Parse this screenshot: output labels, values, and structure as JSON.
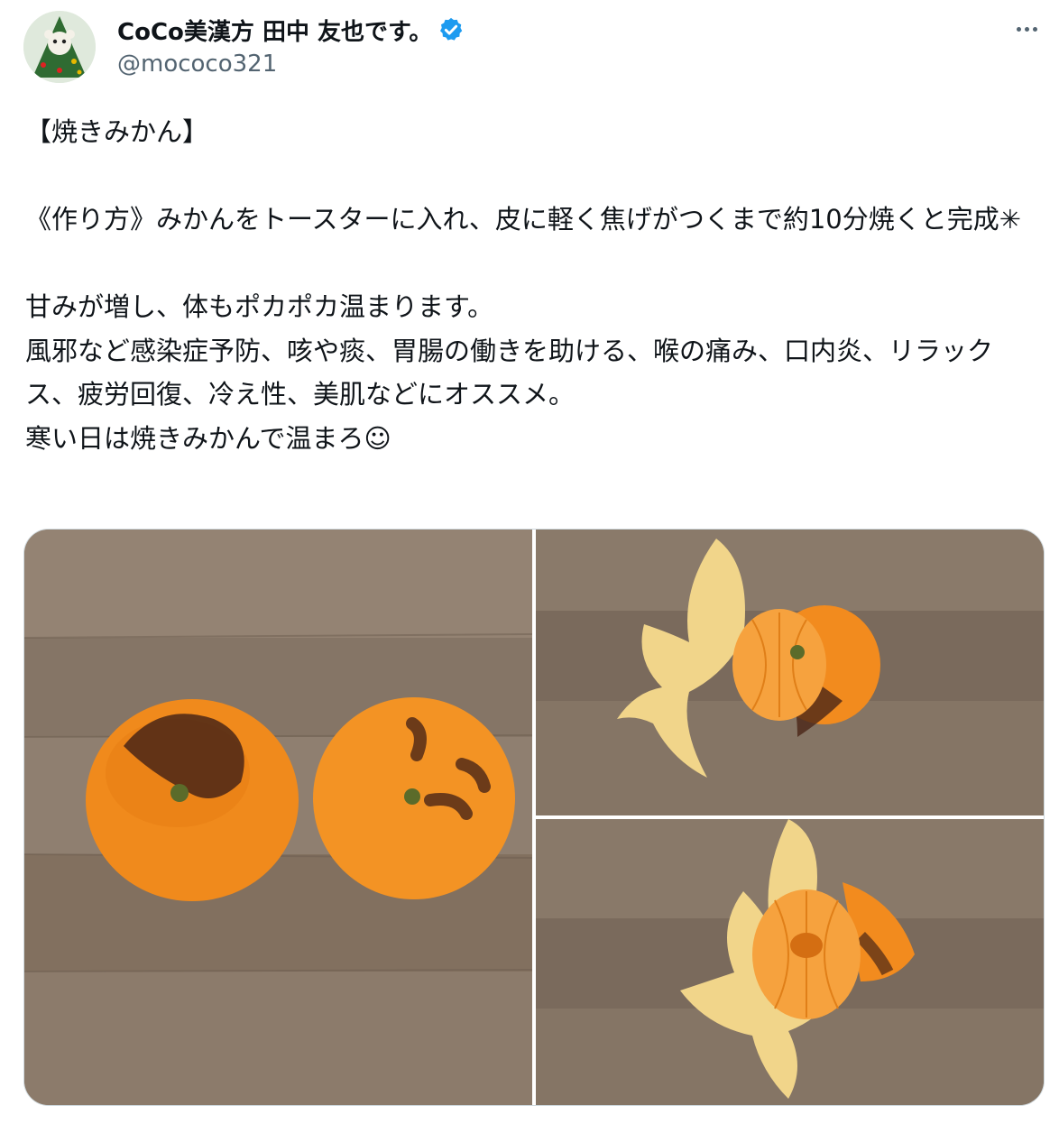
{
  "tweet": {
    "display_name": "CoCo美漢方 田中 友也です。",
    "handle": "@mococo321",
    "verified_icon": "verified-badge-icon",
    "more_icon": "more-options-icon",
    "text": "【焼きみかん】\n\n《作り方》みかんをトースターに入れ、皮に軽く焦げがつくまで約10分焼くと完成✳︎\n\n甘みが増し、体もポカポカ温まります。\n風邪など感染症予防、咳や痰、胃腸の働きを助ける、喉の痛み、口内炎、リラックス、疲労回復、冷え性、美肌などにオススメ。\n寒い日は焼きみかんで温まろ☺︎"
  },
  "colors": {
    "verified_blue": "#1d9bf0",
    "secondary_text": "#536471",
    "orange": "#f08a1c",
    "board": "#8a7a6a"
  }
}
